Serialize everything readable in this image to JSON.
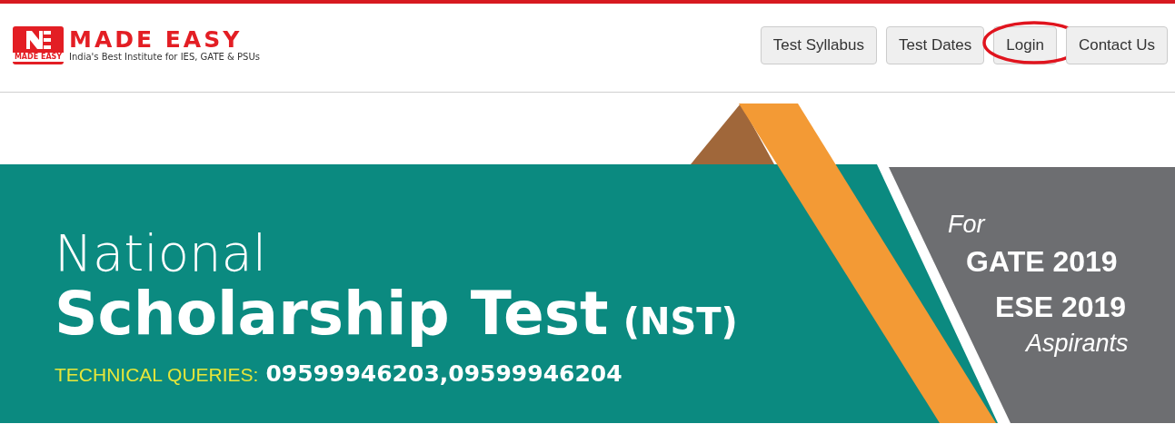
{
  "logo": {
    "name": "MADE EASY",
    "tagline": "India's Best Institute for IES, GATE & PSUs",
    "badge": "MADE EASY"
  },
  "nav": [
    {
      "label": "Test Syllabus",
      "circled": false
    },
    {
      "label": "Test Dates",
      "circled": false
    },
    {
      "label": "Login",
      "circled": true
    },
    {
      "label": "Contact Us",
      "circled": false
    }
  ],
  "banner": {
    "line_1": "National",
    "line_2": "Scholarship Test",
    "suffix": "(NST)",
    "queries_label": "TECHNICAL QUERIES:",
    "queries_numbers": "09599946203,09599946204",
    "for": "For",
    "exam_1": "GATE 2019",
    "exam_2": "ESE 2019",
    "audience": "Aspirants"
  }
}
